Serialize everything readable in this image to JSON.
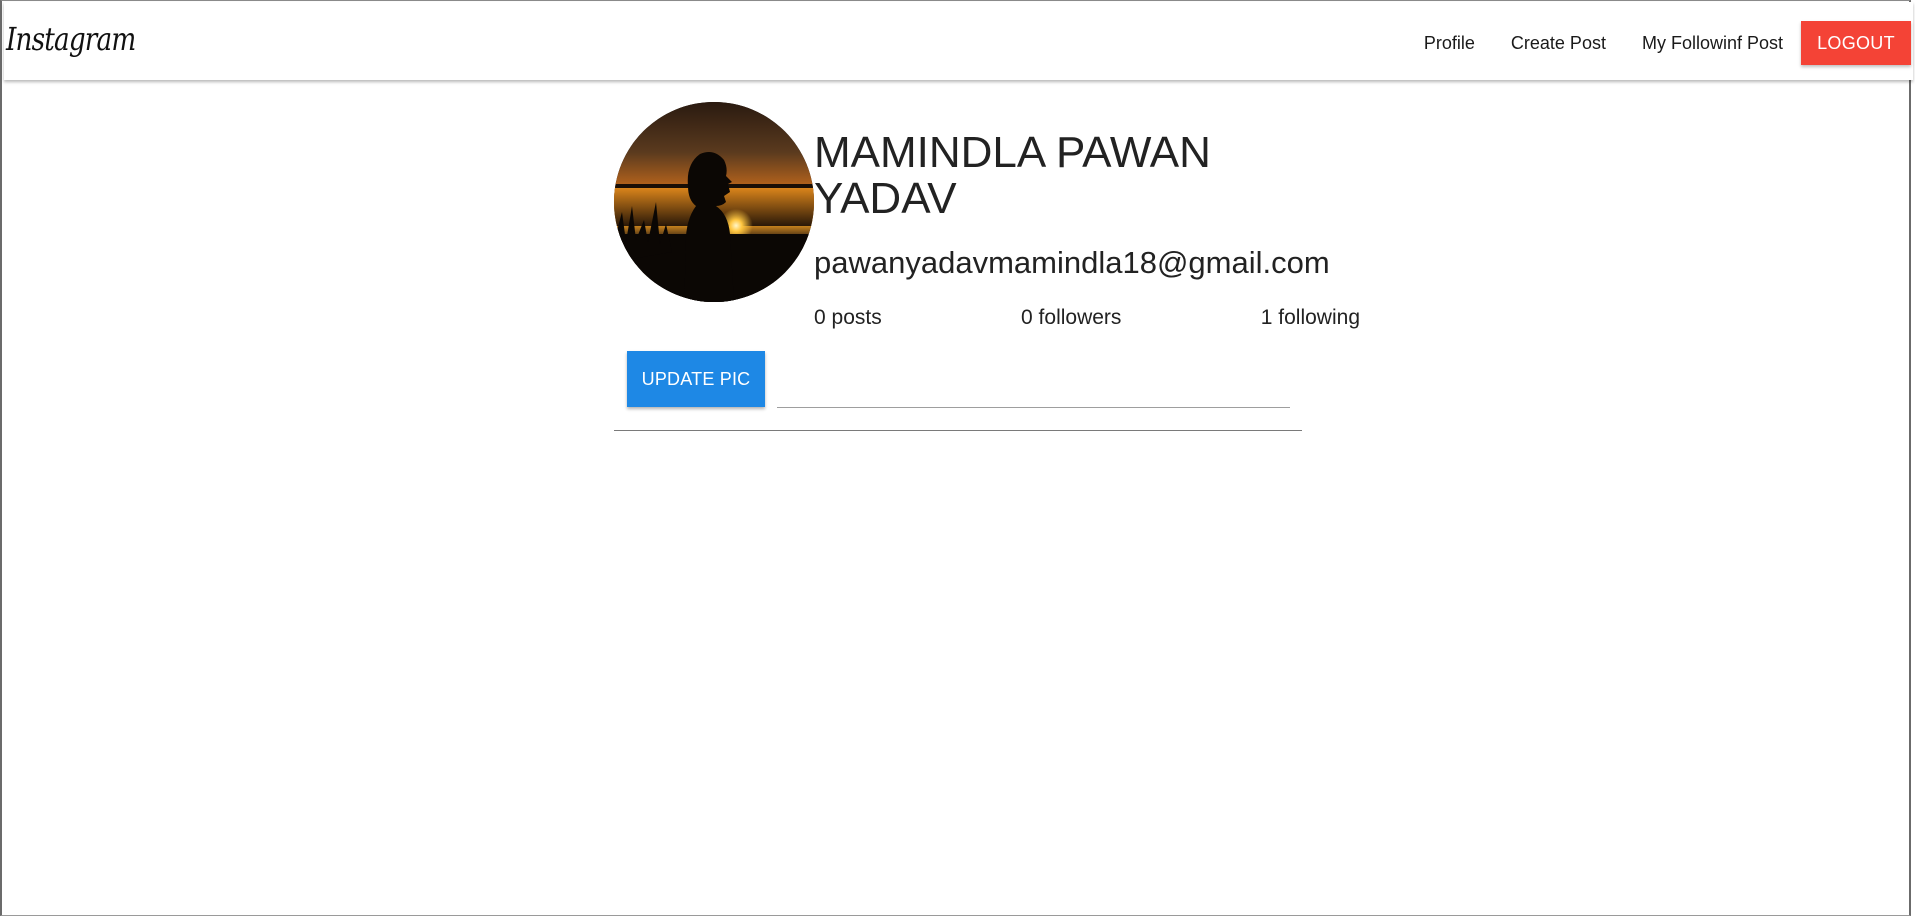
{
  "navbar": {
    "brand": "Instagram",
    "links": [
      "Profile",
      "Create Post",
      "My Followinf Post"
    ],
    "logout_label": "LOGOUT"
  },
  "profile": {
    "name": "MAMINDLA PAWAN YADAV",
    "email": "pawanyadavmamindla18@gmail.com",
    "stats": {
      "posts": "0 posts",
      "followers": "0 followers",
      "following": "1 following"
    },
    "update_pic_label": "UPDATE PIC",
    "file_path_value": ""
  },
  "colors": {
    "logout": "#f44336",
    "update_button": "#1e88e5"
  }
}
